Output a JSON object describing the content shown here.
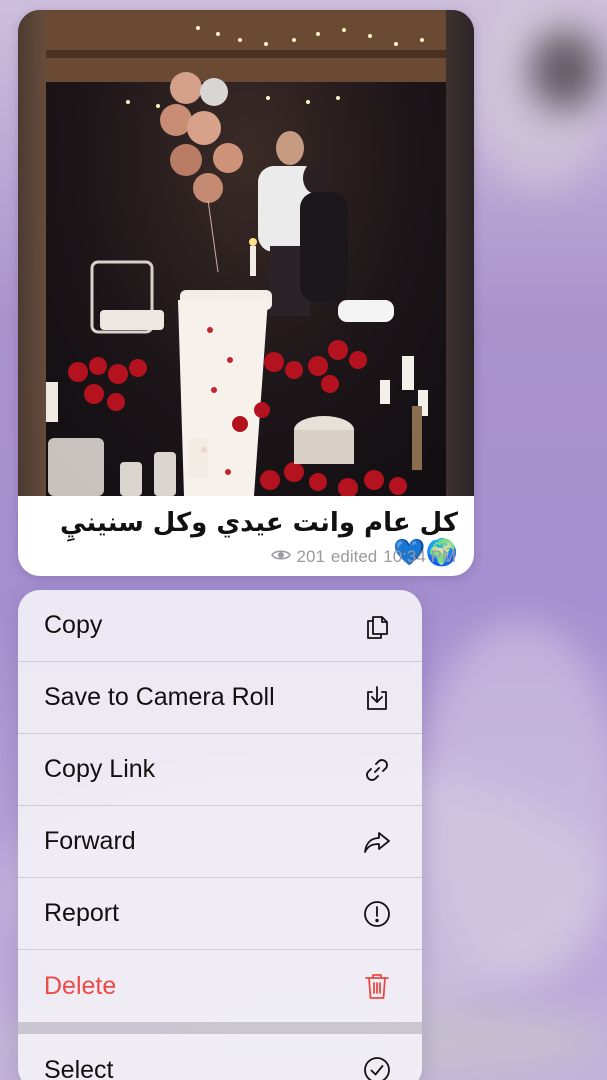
{
  "message": {
    "caption": "كل عام وانت عيدي وكل سنينيِ🌍💙",
    "views": "201",
    "edited_label": "edited",
    "time": "10:34 PM",
    "photo_alt": "couple at candlelit dinner with balloons and roses"
  },
  "menu": {
    "items": [
      {
        "label": "Copy",
        "icon": "copy-icon"
      },
      {
        "label": "Save to Camera Roll",
        "icon": "save-download-icon"
      },
      {
        "label": "Copy Link",
        "icon": "link-icon"
      },
      {
        "label": "Forward",
        "icon": "forward-arrow-icon"
      },
      {
        "label": "Report",
        "icon": "report-exclamation-icon"
      },
      {
        "label": "Delete",
        "icon": "trash-icon"
      },
      {
        "label": "Select",
        "icon": "checkmark-circle-icon"
      }
    ]
  },
  "colors": {
    "destructive": "#ea4b45",
    "menu_text": "#111111",
    "meta_text": "#9a9a9f",
    "backdrop": "#a58fd0"
  }
}
